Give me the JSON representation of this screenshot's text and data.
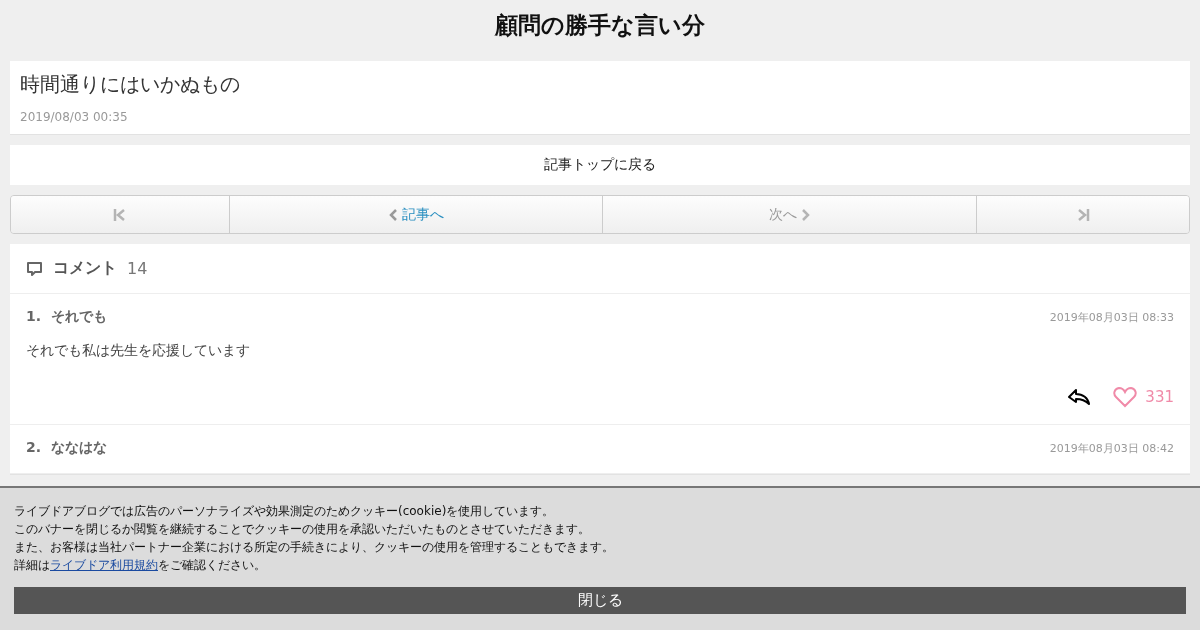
{
  "blog_title": "顧問の勝手な言い分",
  "article": {
    "title": "時間通りにはいかぬもの",
    "date": "2019/08/03 00:35"
  },
  "back_link": "記事トップに戻る",
  "pager": [
    {
      "kind": "first",
      "disabled": true
    },
    {
      "kind": "prev",
      "label": "記事へ",
      "disabled": false
    },
    {
      "kind": "next",
      "label": "次へ",
      "disabled": true
    },
    {
      "kind": "last",
      "disabled": true
    }
  ],
  "comments": {
    "heading": "コメント",
    "count": "14",
    "items": [
      {
        "number": "1.",
        "author": "それでも",
        "date": "2019年08月03日 08:33",
        "body": "それでも私は先生を応援しています",
        "likes": "331"
      },
      {
        "number": "2.",
        "author": "ななはな",
        "date": "2019年08月03日 08:42"
      }
    ]
  },
  "cookie_banner": {
    "lines": [
      "ライブドアブログでは広告のパーソナライズや効果測定のためクッキー(cookie)を使用しています。",
      "このバナーを閉じるか閲覧を継続することでクッキーの使用を承認いただいたものとさせていただきます。",
      "また、お客様は当社パートナー企業における所定の手続きにより、クッキーの使用を管理することもできます。"
    ],
    "detail": {
      "before": "詳細は",
      "link": "ライブドア利用規約",
      "after": "をご確認ください。"
    },
    "close_button": "閉じる"
  }
}
